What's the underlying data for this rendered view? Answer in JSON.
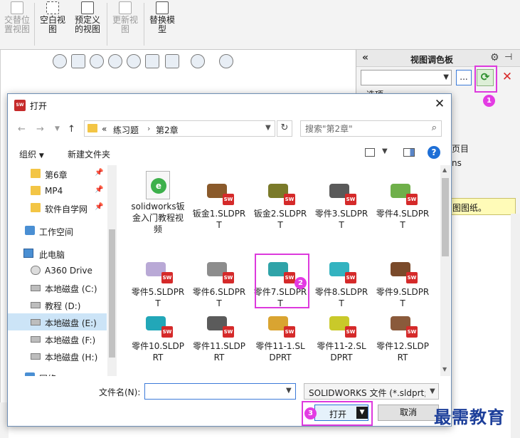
{
  "ribbon": {
    "buttons": [
      {
        "label": "交替位\n置视图",
        "disabled": true
      },
      {
        "label": "空白视\n图",
        "disabled": false
      },
      {
        "label": "预定义\n的视图",
        "disabled": false
      },
      {
        "label": "更新视\n图",
        "disabled": true
      },
      {
        "label": "替换模\n型",
        "disabled": false
      }
    ]
  },
  "palette": {
    "title": "视图调色板",
    "browse_label": "...",
    "options_label": "选项",
    "partial_text_1": "页目",
    "partial_text_2": "ns",
    "hint_text": "图图纸。"
  },
  "dialog": {
    "title": "打开",
    "address": {
      "overflow": "«",
      "crumbs": [
        "练习题",
        "第2章"
      ]
    },
    "search_placeholder": "搜索\"第2章\"",
    "organize_label": "组织",
    "new_folder_label": "新建文件夹",
    "help_label": "?",
    "nav_items": [
      {
        "label": "第6章",
        "icon": "folder",
        "pinned": true
      },
      {
        "label": "MP4",
        "icon": "folder",
        "pinned": true
      },
      {
        "label": "软件自学网",
        "icon": "folder",
        "pinned": true
      },
      {
        "label": "工作空间",
        "icon": "workspace",
        "pinned": false
      },
      {
        "label": "此电脑",
        "icon": "pc",
        "pinned": false
      },
      {
        "label": "A360 Drive",
        "icon": "a360",
        "pinned": false
      },
      {
        "label": "本地磁盘 (C:)",
        "icon": "drive",
        "pinned": false
      },
      {
        "label": "教程 (D:)",
        "icon": "drive",
        "pinned": false
      },
      {
        "label": "本地磁盘 (E:)",
        "icon": "drive",
        "pinned": false,
        "selected": true
      },
      {
        "label": "本地磁盘 (F:)",
        "icon": "drive",
        "pinned": false
      },
      {
        "label": "本地磁盘 (H:)",
        "icon": "drive",
        "pinned": false
      },
      {
        "label": "网络",
        "icon": "network",
        "pinned": false
      }
    ],
    "files": [
      {
        "name": "solidworks钣金入门教程视频",
        "type": "doc"
      },
      {
        "name": "钣金1.SLDPRT",
        "type": "part",
        "color": "#8a5a2b"
      },
      {
        "name": "钣金2.SLDPRT",
        "type": "part",
        "color": "#7a7a2a"
      },
      {
        "name": "零件3.SLDPRT",
        "type": "part",
        "color": "#5a5a5a"
      },
      {
        "name": "零件4.SLDPRT",
        "type": "part",
        "color": "#6fb04a"
      },
      {
        "name": "零件5.SLDPRT",
        "type": "part",
        "color": "#b9a9d6"
      },
      {
        "name": "零件6.SLDPRT",
        "type": "part",
        "color": "#8d8d8d"
      },
      {
        "name": "零件7.SLDPRT",
        "type": "part",
        "color": "#2fa3a8",
        "selected": true
      },
      {
        "name": "零件8.SLDPRT",
        "type": "part",
        "color": "#33b3c0"
      },
      {
        "name": "零件9.SLDPRT",
        "type": "part",
        "color": "#7a4a2a"
      },
      {
        "name": "零件10.SLDPRT",
        "type": "part",
        "color": "#22a7b8"
      },
      {
        "name": "零件11.SLDPRT",
        "type": "part",
        "color": "#5b5b5b"
      },
      {
        "name": "零件11-1.SLDPRT",
        "type": "part",
        "color": "#d9a431"
      },
      {
        "name": "零件11-2.SLDPRT",
        "type": "part",
        "color": "#c9c92a"
      },
      {
        "name": "零件12.SLDPRT",
        "type": "part",
        "color": "#8a5a3b"
      }
    ],
    "filename_label": "文件名(N):",
    "filename_value": "",
    "filetype_value": "SOLIDWORKS 文件 (*.sldprt;",
    "open_label": "打开",
    "cancel_label": "取消"
  },
  "callouts": [
    "1",
    "2",
    "3"
  ],
  "watermark": "最需教育",
  "colors": {
    "highlight": "#dd39dd",
    "accent": "#2a74d6",
    "sw_red": "#d52a2a"
  }
}
